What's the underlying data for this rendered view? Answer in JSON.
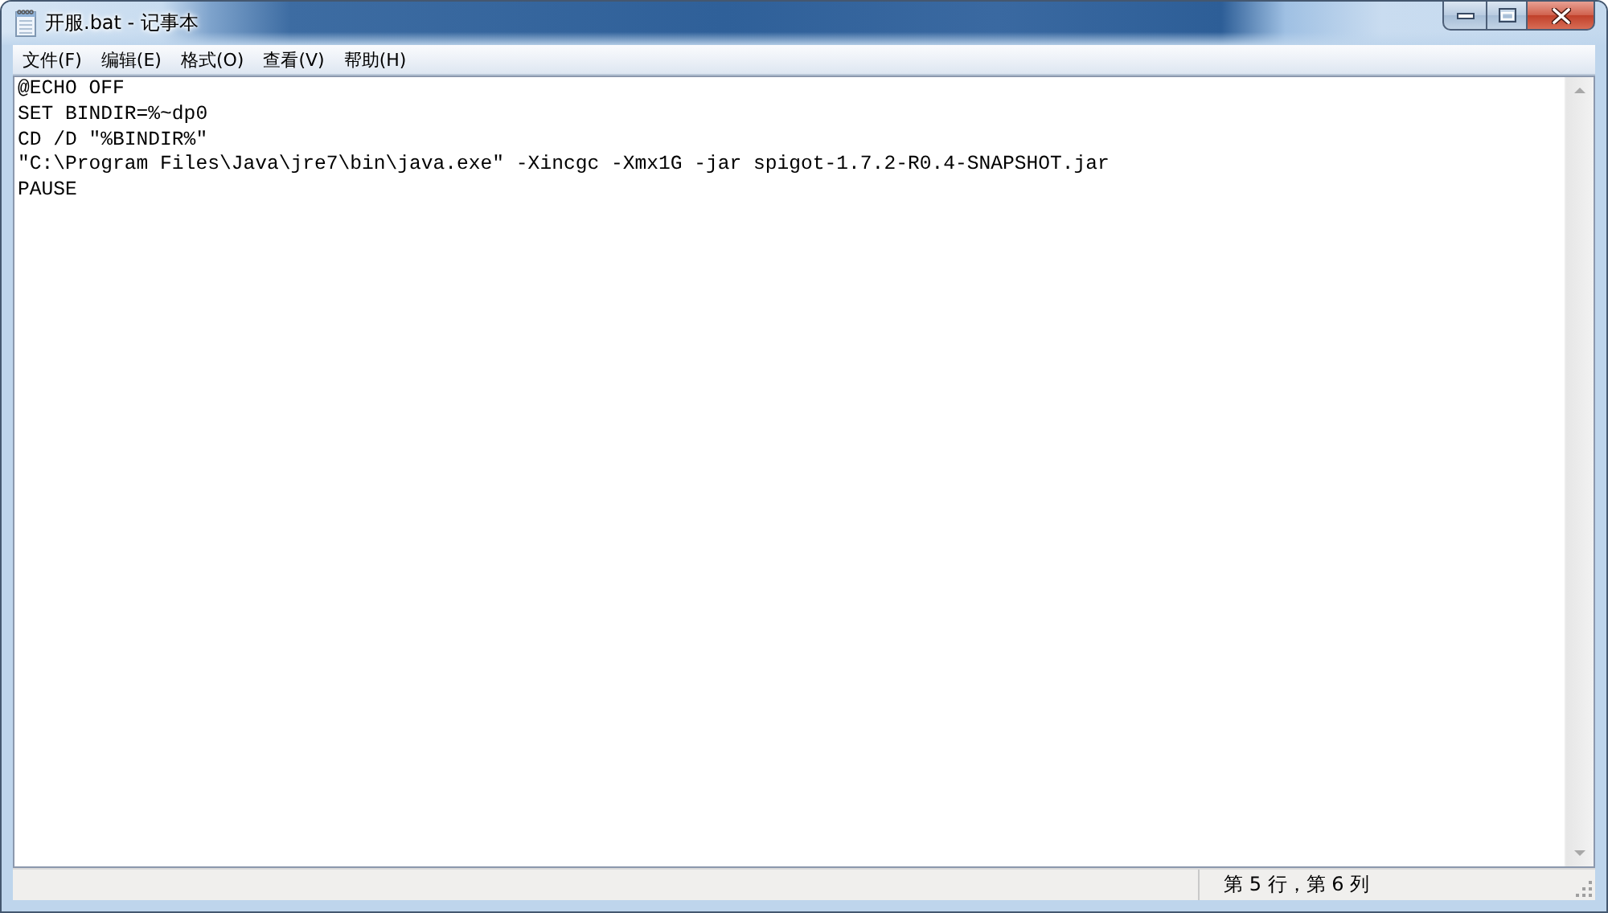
{
  "window": {
    "title": "开服.bat - 记事本"
  },
  "menu": [
    {
      "label": "文件(F)"
    },
    {
      "label": "编辑(E)"
    },
    {
      "label": "格式(O)"
    },
    {
      "label": "查看(V)"
    },
    {
      "label": "帮助(H)"
    }
  ],
  "editor": {
    "lines": [
      "@ECHO OFF",
      "SET BINDIR=%~dp0",
      "CD /D \"%BINDIR%\"",
      "\"C:\\Program Files\\Java\\jre7\\bin\\java.exe\" -Xincgc -Xmx1G -jar spigot-1.7.2-R0.4-SNAPSHOT.jar",
      "PAUSE"
    ]
  },
  "status_bar": {
    "position": "第 5 行，第 6 列"
  }
}
